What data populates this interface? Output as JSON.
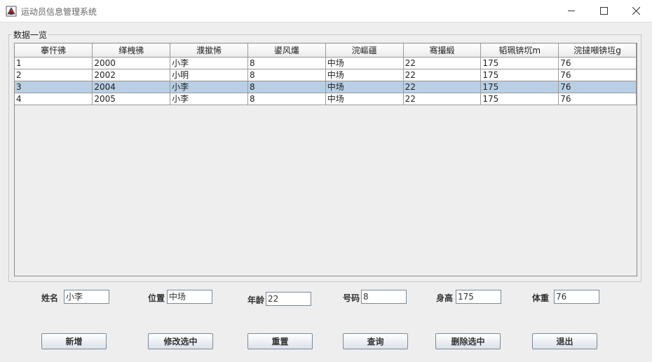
{
  "window": {
    "title": "运动员信息管理系统",
    "icons": {
      "app": "java-cup-icon",
      "minimize": "minimize-icon",
      "maximize": "maximize-icon",
      "close": "close-icon"
    }
  },
  "group": {
    "title": "数据一览"
  },
  "table": {
    "headers": [
      "搴忓彿",
      "缂栧彿",
      "濮撳悕",
      "鍙风爜",
      "浣嶇疆",
      "骞撮緞",
      "韬珮锛坈m",
      "浣撻噸锛坘g"
    ],
    "rows": [
      [
        "1",
        "2000",
        "小李",
        "8",
        "中场",
        "22",
        "175",
        "76"
      ],
      [
        "2",
        "2002",
        "小明",
        "8",
        "中场",
        "22",
        "175",
        "76"
      ],
      [
        "3",
        "2004",
        "小李",
        "8",
        "中场",
        "22",
        "175",
        "76"
      ],
      [
        "4",
        "2005",
        "小李",
        "8",
        "中场",
        "22",
        "175",
        "76"
      ]
    ],
    "selected_row_index": 2,
    "colors": {
      "selected": "#b8cfe5"
    }
  },
  "form": {
    "name": {
      "label": "姓名",
      "value": "小李"
    },
    "position": {
      "label": "位置",
      "value": "中场"
    },
    "age": {
      "label": "年龄",
      "value": "22"
    },
    "number": {
      "label": "号码",
      "value": "8"
    },
    "height": {
      "label": "身高",
      "value": "175"
    },
    "weight": {
      "label": "体重",
      "value": "76"
    }
  },
  "buttons": {
    "add": "新增",
    "modify": "修改选中",
    "reset": "重置",
    "query": "查询",
    "delete": "删除选中",
    "exit": "退出"
  }
}
